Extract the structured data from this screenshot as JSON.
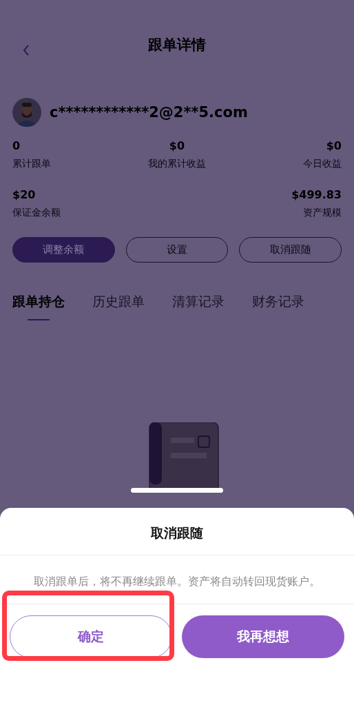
{
  "header": {
    "title": "跟单详情"
  },
  "user": {
    "email": "c************2@2**5.com"
  },
  "stats": [
    [
      {
        "value": "0",
        "label": "累计跟单"
      },
      {
        "value": "$0",
        "label": "我的累计收益"
      },
      {
        "value": "$0",
        "label": "今日收益"
      }
    ],
    [
      {
        "value": "$20",
        "label": "保证金余额"
      },
      {
        "value": "$499.83",
        "label": "资产规模"
      }
    ]
  ],
  "actions": [
    {
      "label": "调整余额",
      "kind": "primary"
    },
    {
      "label": "设置",
      "kind": "outline"
    },
    {
      "label": "取消跟随",
      "kind": "outline"
    }
  ],
  "tabs": [
    {
      "label": "跟单持仓",
      "selected": true
    },
    {
      "label": "历史跟单",
      "selected": false
    },
    {
      "label": "清算记录",
      "selected": false
    },
    {
      "label": "财务记录",
      "selected": false
    }
  ],
  "dialog": {
    "title": "取消跟随",
    "message": "取消跟单后，将不再继续跟单。资产将自动转回现货账户。",
    "buttons": [
      {
        "label": "确定",
        "kind": "outline",
        "highlighted": true
      },
      {
        "label": "我再想想",
        "kind": "primary",
        "highlighted": false
      }
    ]
  }
}
